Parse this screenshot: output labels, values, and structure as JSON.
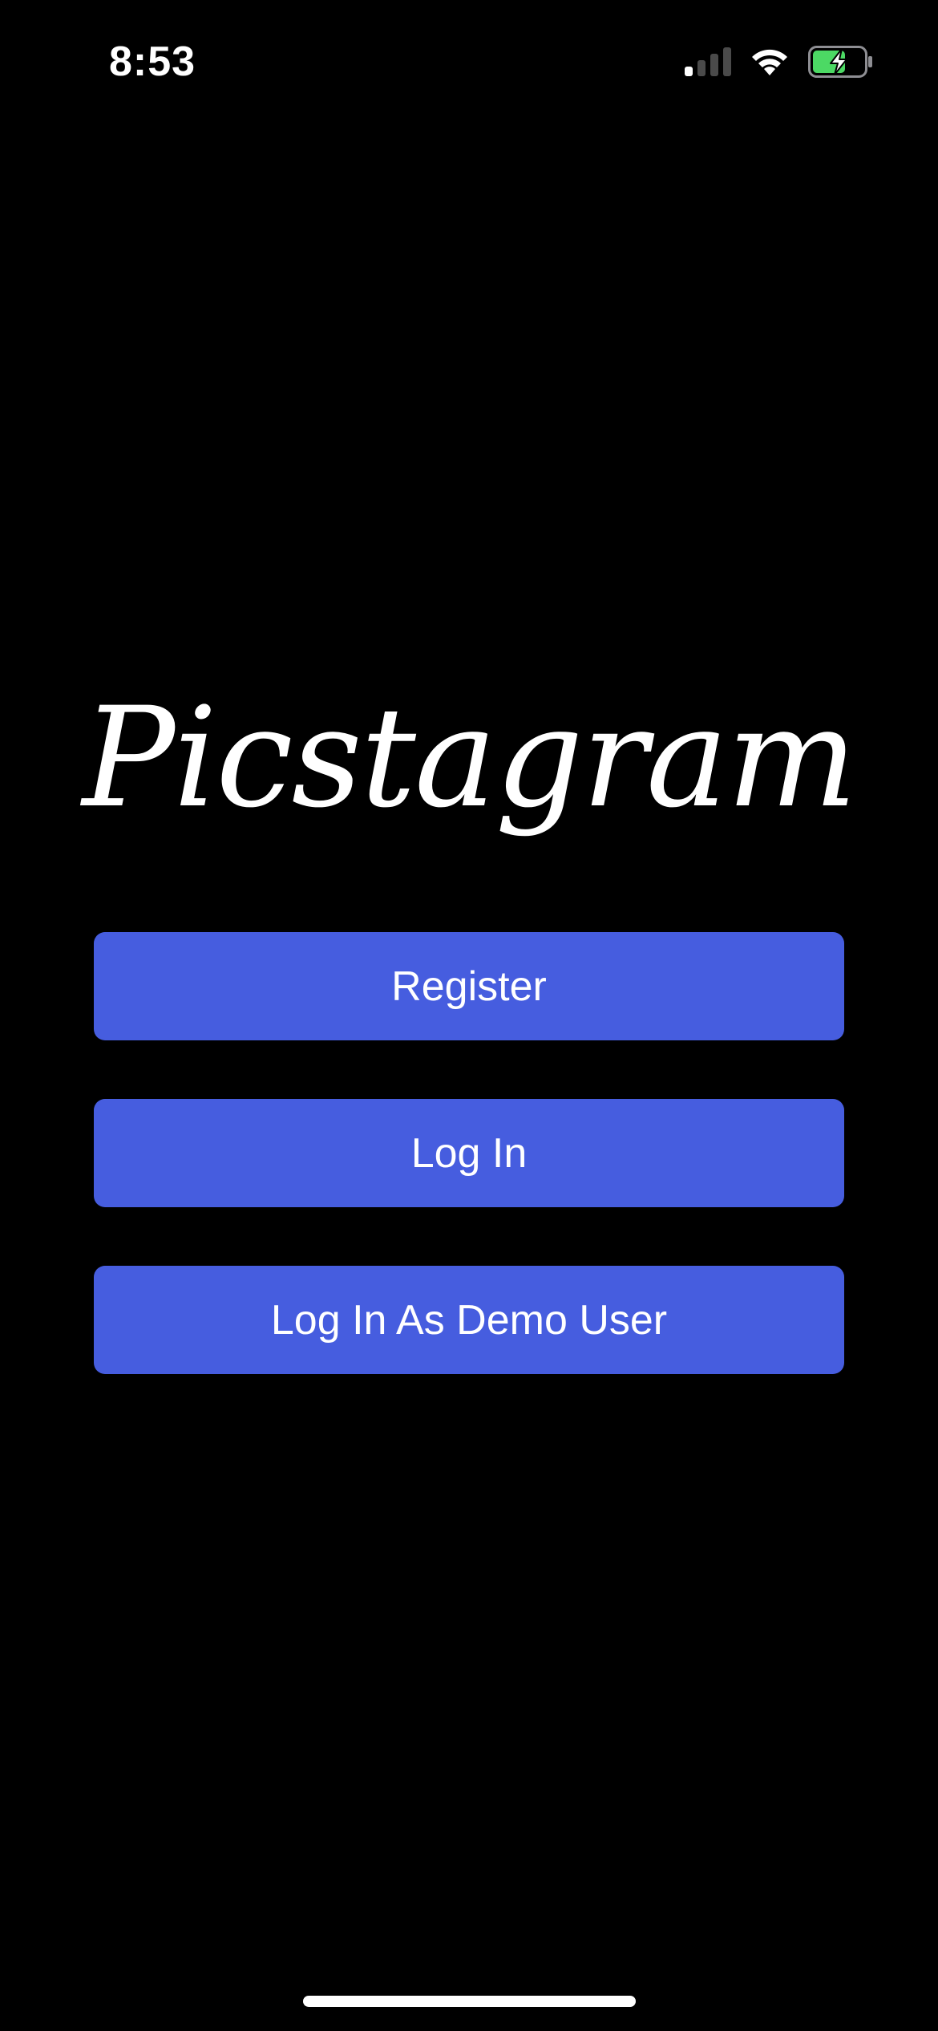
{
  "status_bar": {
    "time": "8:53",
    "icons": [
      "cellular-signal-icon",
      "wifi-icon",
      "battery-charging-icon"
    ],
    "battery_color": "#4cd964"
  },
  "logo": {
    "text": "Picstagram"
  },
  "buttons": {
    "register_label": "Register",
    "login_label": "Log In",
    "demo_label": "Log In As Demo User"
  },
  "colors": {
    "background": "#000000",
    "button": "#465ddf",
    "text": "#ffffff"
  }
}
